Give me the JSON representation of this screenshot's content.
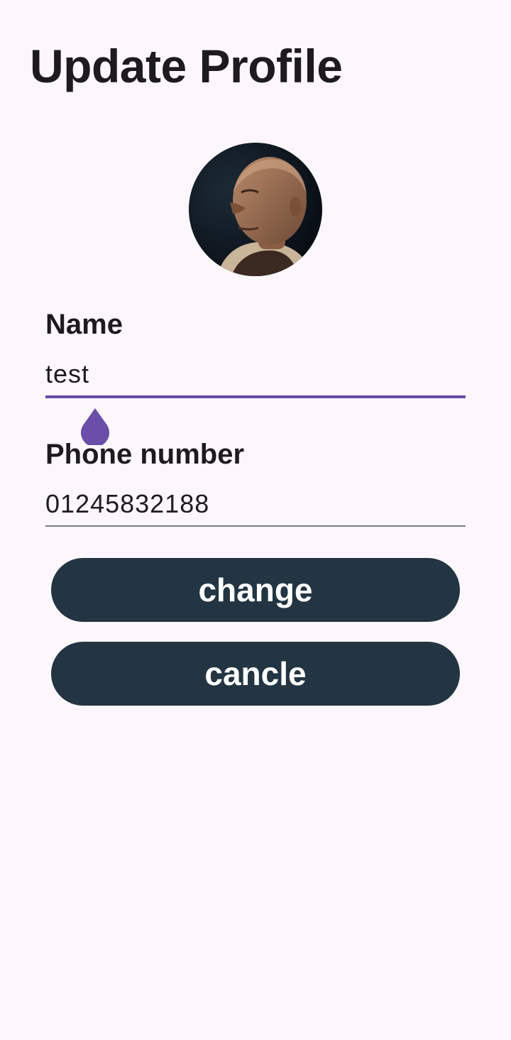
{
  "header": {
    "title": "Update Profile"
  },
  "profile": {
    "avatar_description": "profile-photo"
  },
  "form": {
    "name": {
      "label": "Name",
      "value": "test"
    },
    "phone": {
      "label": "Phone number",
      "value": "01245832188"
    }
  },
  "actions": {
    "change_label": "change",
    "cancel_label": "cancle"
  },
  "colors": {
    "background": "#fdf7fd",
    "accent": "#6a4ea8",
    "button": "#233542",
    "text": "#1d1b20"
  }
}
